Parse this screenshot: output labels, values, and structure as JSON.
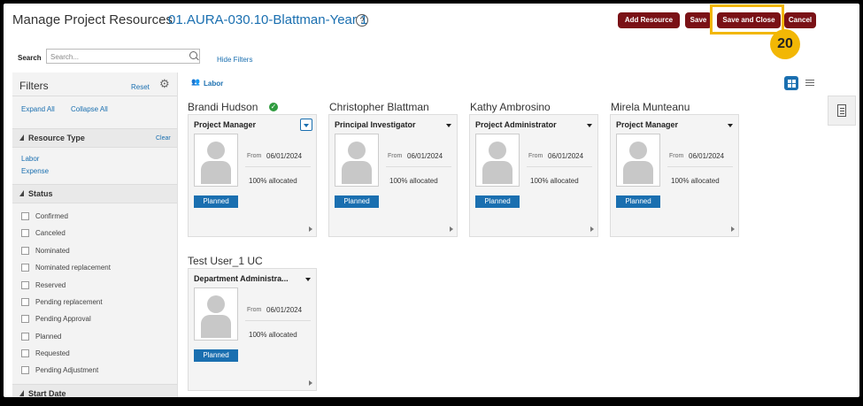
{
  "header": {
    "title": "Manage Project Resources",
    "project": "01.AURA-030.10-Blattman-Year 1",
    "help": "?"
  },
  "buttons": {
    "add_resource": "Add Resource",
    "save": "Save",
    "save_close": "Save and Close",
    "cancel": "Cancel"
  },
  "callout": "20",
  "search": {
    "label": "Search",
    "placeholder": "Search..."
  },
  "hide_filters": "Hide Filters",
  "filters": {
    "title": "Filters",
    "reset": "Reset",
    "expand_all": "Expand All",
    "collapse_all": "Collapse All",
    "resource_type": {
      "title": "Resource Type",
      "clear": "Clear",
      "items": [
        "Labor",
        "Expense"
      ]
    },
    "status": {
      "title": "Status",
      "items": [
        "Confirmed",
        "Canceled",
        "Nominated",
        "Nominated replacement",
        "Reserved",
        "Pending replacement",
        "Pending Approval",
        "Planned",
        "Requested",
        "Pending Adjustment"
      ]
    },
    "start_date": {
      "title": "Start Date"
    }
  },
  "section_label": "Labor",
  "resources": [
    {
      "name": "Brandi Hudson",
      "role": "Project Manager",
      "from_label": "From",
      "from_date": "06/01/2024",
      "allocation": "100% allocated",
      "status": "Planned"
    },
    {
      "name": "Christopher Blattman",
      "role": "Principal Investigator",
      "from_label": "From",
      "from_date": "06/01/2024",
      "allocation": "100% allocated",
      "status": "Planned"
    },
    {
      "name": "Kathy Ambrosino",
      "role": "Project Administrator",
      "from_label": "From",
      "from_date": "06/01/2024",
      "allocation": "100% allocated",
      "status": "Planned"
    },
    {
      "name": "Mirela Munteanu",
      "role": "Project Manager",
      "from_label": "From",
      "from_date": "06/01/2024",
      "allocation": "100% allocated",
      "status": "Planned"
    },
    {
      "name": "Test User_1 UC",
      "role": "Department Administra...",
      "from_label": "From",
      "from_date": "06/01/2024",
      "allocation": "100% allocated",
      "status": "Planned"
    }
  ],
  "colors": {
    "brand_button": "#7a1116",
    "link": "#1a6fb0",
    "highlight": "#f2b705",
    "verified": "#2e9b3e"
  },
  "icons": [
    "help-icon",
    "search-icon",
    "gear-icon",
    "labor-icon",
    "grid-view-icon",
    "list-view-icon",
    "document-icon",
    "verified-check-icon",
    "dropdown-caret-icon",
    "person-placeholder-icon",
    "next-arrow-icon"
  ]
}
